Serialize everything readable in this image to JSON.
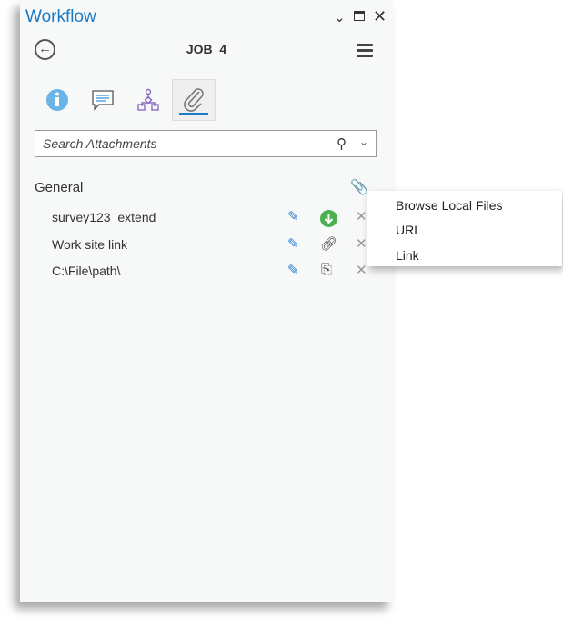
{
  "panel": {
    "title": "Workflow",
    "job": "JOB_4"
  },
  "search": {
    "placeholder": "Search Attachments"
  },
  "section": {
    "label": "General"
  },
  "attachments": [
    {
      "name": "survey123_extend",
      "type": "download"
    },
    {
      "name": "Work site link",
      "type": "link"
    },
    {
      "name": "C:\\File\\path\\",
      "type": "file"
    }
  ],
  "add_menu": {
    "items": [
      "Browse Local Files",
      "URL",
      "Link"
    ]
  },
  "colors": {
    "accent": "#1a7bc6",
    "download": "#4caf50"
  }
}
